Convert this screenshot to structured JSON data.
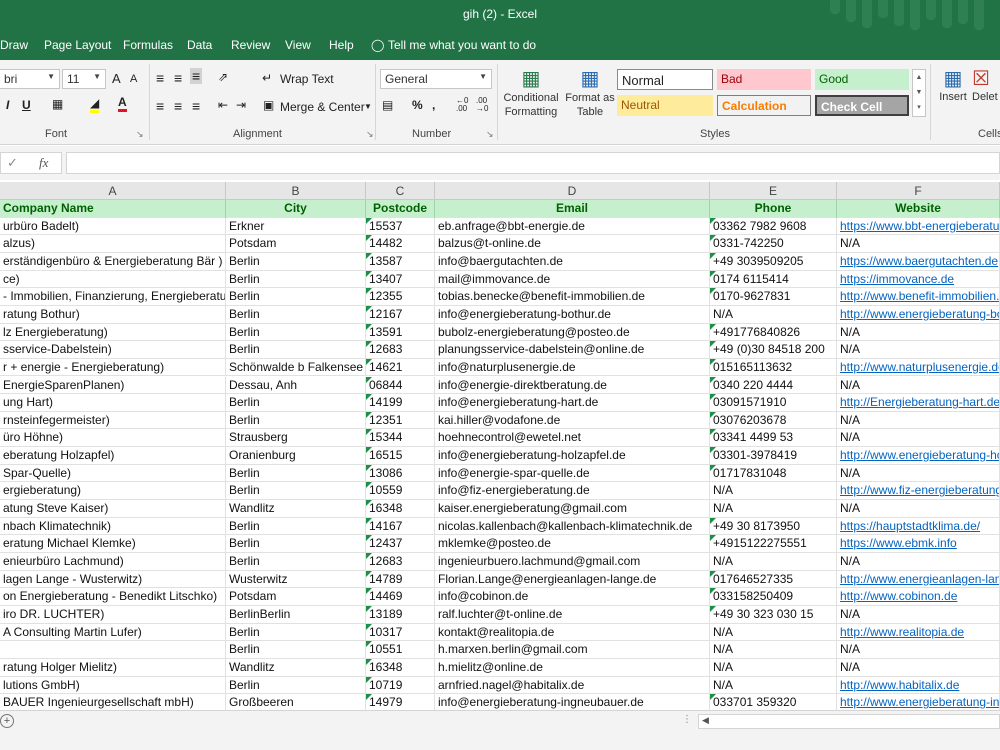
{
  "window": {
    "title": "gih (2)  -  Excel"
  },
  "ribbon_tabs": [
    "Draw",
    "Page Layout",
    "Formulas",
    "Data",
    "Review",
    "View",
    "Help"
  ],
  "tell_me": "Tell me what you want to do",
  "font": {
    "name": "bri",
    "size": "11",
    "grow": "A",
    "shrink": "A",
    "italic": "I",
    "underline": "U",
    "group_label": "Font"
  },
  "alignment": {
    "wrap_text": "Wrap Text",
    "merge_center": "Merge & Center",
    "group_label": "Alignment"
  },
  "number": {
    "format": "General",
    "percent": "%",
    "comma": ",",
    "inc_decimal": ".00\n←.0",
    "group_label": "Number"
  },
  "styles": {
    "conditional_formatting": "Conditional Formatting",
    "format_as_table": "Format as Table",
    "normal": "Normal",
    "bad": "Bad",
    "good": "Good",
    "neutral": "Neutral",
    "calculation": "Calculation",
    "check_cell": "Check Cell",
    "group_label": "Styles"
  },
  "cells": {
    "insert": "Insert",
    "delete": "Delet",
    "group_label": "Cells"
  },
  "formula_bar": {
    "fx": "fx",
    "content": ""
  },
  "columns": [
    "A",
    "B",
    "C",
    "D",
    "E",
    "F"
  ],
  "header_row": [
    "Company Name",
    "City",
    "Postcode",
    "Email",
    "Phone",
    "Website"
  ],
  "rows": [
    [
      "urbüro Badelt)",
      "Erkner",
      "15537",
      "eb.anfrage@bbt-energie.de",
      "03362 7982 9608",
      "https://www.bbt-energieberatung.de"
    ],
    [
      "alzus)",
      "Potsdam",
      "14482",
      "balzus@t-online.de",
      "0331-742250",
      "N/A"
    ],
    [
      "erständigenbüro & Energieberatung Bär )",
      "Berlin",
      "13587",
      "info@baergutachten.de",
      "+49 3039509205",
      "https://www.baergutachten.de"
    ],
    [
      "ce)",
      "Berlin",
      "13407",
      "mail@immovance.de",
      "0174 6115414",
      "https://immovance.de"
    ],
    [
      " - Immobilien, Finanzierung, Energieberatung",
      "Berlin",
      "12355",
      "tobias.benecke@benefit-immobilien.de",
      "0170-9627831",
      "http://www.benefit-immobilien.de"
    ],
    [
      "ratung Bothur)",
      "Berlin",
      "12167",
      "info@energieberatung-bothur.de",
      "N/A",
      "http://www.energieberatung-bothur.de"
    ],
    [
      "lz Energieberatung)",
      "Berlin",
      "13591",
      "bubolz-energieberatung@posteo.de",
      "+491776840826",
      "N/A"
    ],
    [
      "sservice-Dabelstein)",
      "Berlin",
      "12683",
      "planungsservice-dabelstein@online.de",
      "+49 (0)30 84518 200",
      "N/A"
    ],
    [
      "r + energie - Energieberatung)",
      "Schönwalde b Falkensee",
      "14621",
      "info@naturplusenergie.de",
      "015165113632",
      "http://www.naturplusenergie.de"
    ],
    [
      "EnergieSparenPlanen)",
      "Dessau, Anh",
      "06844",
      "info@energie-direktberatung.de",
      "0340 220 4444",
      "N/A"
    ],
    [
      "ung Hart)",
      "Berlin",
      "14199",
      "info@energieberatung-hart.de",
      "03091571910",
      "http://Energieberatung-hart.de"
    ],
    [
      "rnsteinfegermeister)",
      "Berlin",
      "12351",
      "kai.hiller@vodafone.de",
      "03076203678",
      "N/A"
    ],
    [
      "üro Höhne)",
      "Strausberg",
      "15344",
      "hoehnecontrol@ewetel.net",
      "03341 4499 53",
      "N/A"
    ],
    [
      "eberatung Holzapfel)",
      "Oranienburg",
      "16515",
      "info@energieberatung-holzapfel.de",
      "03301-3978419",
      "http://www.energieberatung-holzapfel.de"
    ],
    [
      "Spar-Quelle)",
      "Berlin",
      "13086",
      "info@energie-spar-quelle.de",
      "01717831048",
      "N/A"
    ],
    [
      "ergieberatung)",
      "Berlin",
      "10559",
      "info@fiz-energieberatung.de",
      "N/A",
      "http://www.fiz-energieberatung.de"
    ],
    [
      "atung Steve Kaiser)",
      "Wandlitz",
      "16348",
      "kaiser.energieberatung@gmail.com",
      "N/A",
      "N/A"
    ],
    [
      "nbach Klimatechnik)",
      "Berlin",
      "14167",
      "nicolas.kallenbach@kallenbach-klimatechnik.de",
      "+49 30 8173950",
      "https://hauptstadtklima.de/"
    ],
    [
      "eratung Michael Klemke)",
      "Berlin",
      "12437",
      "mklemke@posteo.de",
      "+4915122275551",
      "https://www.ebmk.info"
    ],
    [
      "enieurbüro Lachmund)",
      "Berlin",
      "12683",
      "ingenieurbuero.lachmund@gmail.com",
      "N/A",
      "N/A"
    ],
    [
      "lagen Lange - Wusterwitz)",
      "Wusterwitz",
      "14789",
      "Florian.Lange@energieanlagen-lange.de",
      "017646527335",
      "http://www.energieanlagen-lange.de"
    ],
    [
      "on Energieberatung - Benedikt Litschko)",
      "Potsdam",
      "14469",
      "info@cobinon.de",
      "033158250409",
      "http://www.cobinon.de"
    ],
    [
      "iro DR. LUCHTER)",
      "BerlinBerlin",
      "13189",
      "ralf.luchter@t-online.de",
      "+49 30 323 030 15",
      "N/A"
    ],
    [
      "A Consulting Martin Lufer)",
      "Berlin",
      "10317",
      "kontakt@realitopia.de",
      "N/A",
      "http://www.realitopia.de"
    ],
    [
      "",
      "Berlin",
      "10551",
      "h.marxen.berlin@gmail.com",
      "N/A",
      "N/A"
    ],
    [
      "ratung Holger Mielitz)",
      "Wandlitz",
      "16348",
      "h.mielitz@online.de",
      "N/A",
      "N/A"
    ],
    [
      "lutions GmbH)",
      "Berlin",
      "10719",
      "arnfried.nagel@habitalix.de",
      "N/A",
      "http://www.habitalix.de"
    ],
    [
      "BAUER Ingenieurgesellschaft mbH)",
      "Großbeeren",
      "14979",
      "info@energieberatung-ingneubauer.de",
      "033701 359320",
      "http://www.energieberatung-ingneubauer.de"
    ]
  ],
  "colors": {
    "excel_green": "#217346",
    "header_fill": "#c6efce",
    "header_text": "#006100",
    "link": "#0563c1"
  }
}
